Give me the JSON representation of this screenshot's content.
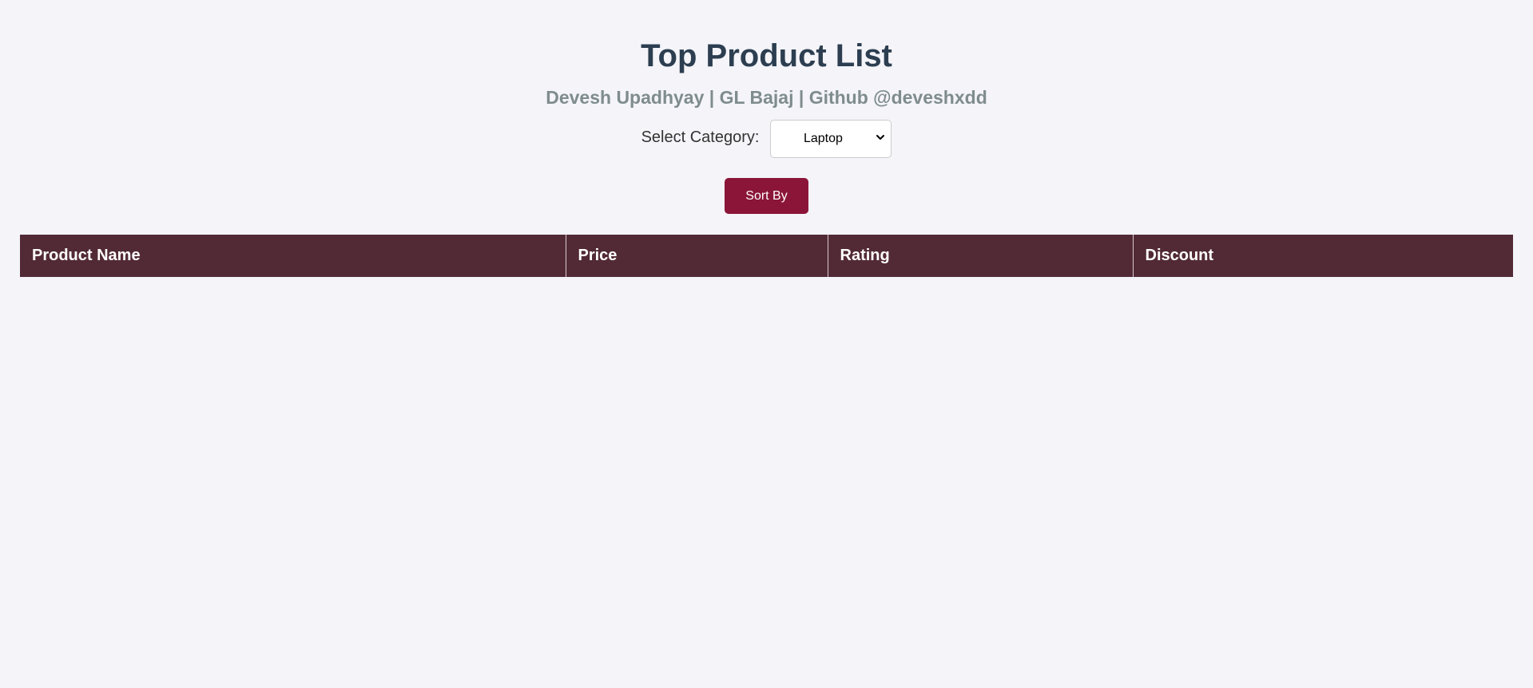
{
  "header": {
    "title": "Top Product List",
    "subtitle": "Devesh Upadhyay | GL Bajaj | Github @deveshxdd"
  },
  "filters": {
    "category_label": "Select Category:",
    "category_selected": "Laptop",
    "chevron_icon": "chevron-down-icon"
  },
  "actions": {
    "sort_label": "Sort By"
  },
  "table": {
    "columns": [
      "Product Name",
      "Price",
      "Rating",
      "Discount"
    ],
    "rows": []
  },
  "colors": {
    "background": "#f4f4f9",
    "title": "#2c3e50",
    "subtitle": "#7f8c8d",
    "sort_button": "#8b1538",
    "table_header": "#522a36"
  }
}
